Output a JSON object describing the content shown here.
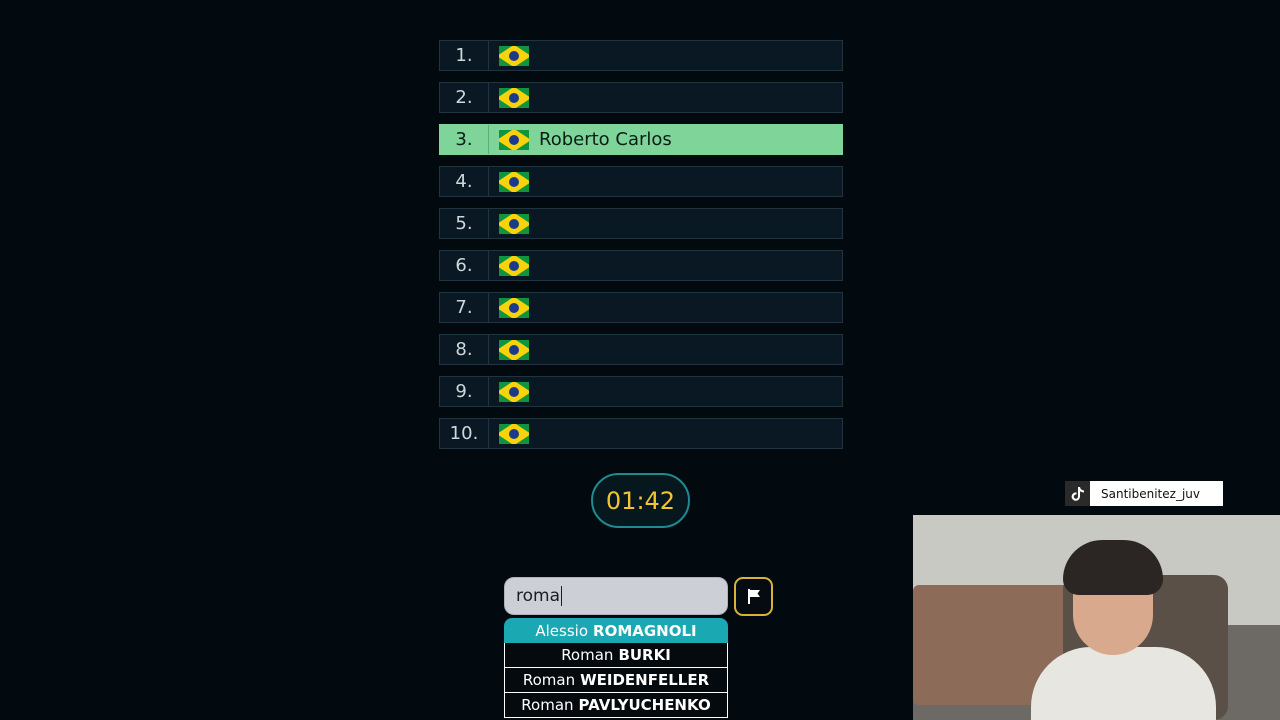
{
  "ranking": [
    {
      "rank": "1.",
      "name": "",
      "found": false
    },
    {
      "rank": "2.",
      "name": "",
      "found": false
    },
    {
      "rank": "3.",
      "name": "Roberto Carlos",
      "found": true
    },
    {
      "rank": "4.",
      "name": "",
      "found": false
    },
    {
      "rank": "5.",
      "name": "",
      "found": false
    },
    {
      "rank": "6.",
      "name": "",
      "found": false
    },
    {
      "rank": "7.",
      "name": "",
      "found": false
    },
    {
      "rank": "8.",
      "name": "",
      "found": false
    },
    {
      "rank": "9.",
      "name": "",
      "found": false
    },
    {
      "rank": "10.",
      "name": "",
      "found": false
    }
  ],
  "flag_icon": "brazil-flag-icon",
  "timer": "01:42",
  "search": {
    "value": "roma"
  },
  "give_up_icon": "flag-icon",
  "suggestions": [
    {
      "first": "Alessio",
      "last": "ROMAGNOLI"
    },
    {
      "first": "Roman",
      "last": "BURKI"
    },
    {
      "first": "Roman",
      "last": "WEIDENFELLER"
    },
    {
      "first": "Roman",
      "last": "PAVLYUCHENKO"
    }
  ],
  "stream_overlay": {
    "platform_icon": "tiktok-icon",
    "handle": "Santibenitez_juv"
  },
  "colors": {
    "found": "#7fd49a",
    "timer": "#f2c431",
    "accent": "#1aa8b3"
  }
}
